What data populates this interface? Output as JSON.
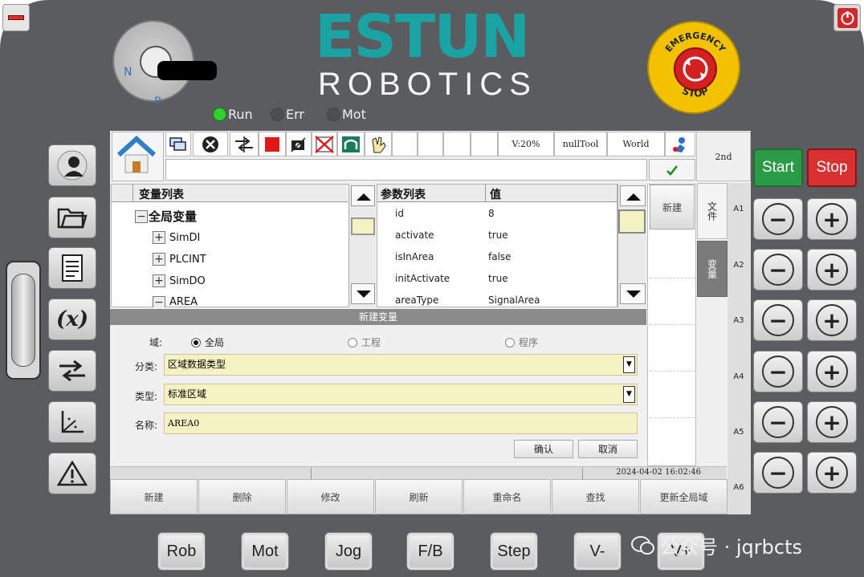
{
  "brand": {
    "logo": "ESTUN",
    "subtitle": "ROBOTICS"
  },
  "key_switch": {
    "n_label": "N",
    "r_label": "R"
  },
  "status_leds": [
    {
      "label": "Run",
      "color": "#2fd32f"
    },
    {
      "label": "Err",
      "color": "#4a4a4a"
    },
    {
      "label": "Mot",
      "color": "#4a4a4a"
    }
  ],
  "emergency": {
    "top_text": "EMERGENCY",
    "bottom_text": "STOP"
  },
  "toolbar": {
    "speed": "V:20%",
    "tool": "nullTool",
    "frame": "World",
    "mode": "2nd"
  },
  "var_tree": {
    "header": "变量列表",
    "root": "全局变量",
    "children": [
      "SimDI",
      "PLCINT",
      "SimDO",
      "AREA"
    ]
  },
  "params": {
    "header_name": "参数列表",
    "header_value": "值",
    "rows": [
      {
        "name": "id",
        "value": "8"
      },
      {
        "name": "activate",
        "value": "true"
      },
      {
        "name": "isInArea",
        "value": "false"
      },
      {
        "name": "initActivate",
        "value": "true"
      },
      {
        "name": "areaType",
        "value": "SignalArea"
      }
    ]
  },
  "right_panel": {
    "new_label": "新建",
    "tab_file": "文件",
    "tab_var": "变量"
  },
  "dialog": {
    "title": "新建变量",
    "scope_label": "域:",
    "scope_options": [
      "全局",
      "工程",
      "程序"
    ],
    "scope_selected": "全局",
    "category_label": "分类:",
    "category_value": "区域数据类型",
    "type_label": "类型:",
    "type_value": "标准区域",
    "name_label": "名称:",
    "name_value": "AREA0",
    "confirm": "确认",
    "cancel": "取消"
  },
  "status_bar": {
    "datetime": "2024-04-02 16:02:46"
  },
  "bottom_tabs": [
    "新建",
    "删除",
    "修改",
    "刷新",
    "重命名",
    "查找",
    "更新全局域"
  ],
  "axes": [
    "A1",
    "A2",
    "A3",
    "A4",
    "A5",
    "A6"
  ],
  "start_btn": {
    "label": "Start",
    "color": "#2a9a46"
  },
  "stop_btn": {
    "label": "Stop",
    "color": "#d93030"
  },
  "mode_buttons": [
    "Rob",
    "Mot",
    "Jog",
    "F/B",
    "Step",
    "V-",
    "V+"
  ],
  "watermark": "公众号 · jqrbcts"
}
